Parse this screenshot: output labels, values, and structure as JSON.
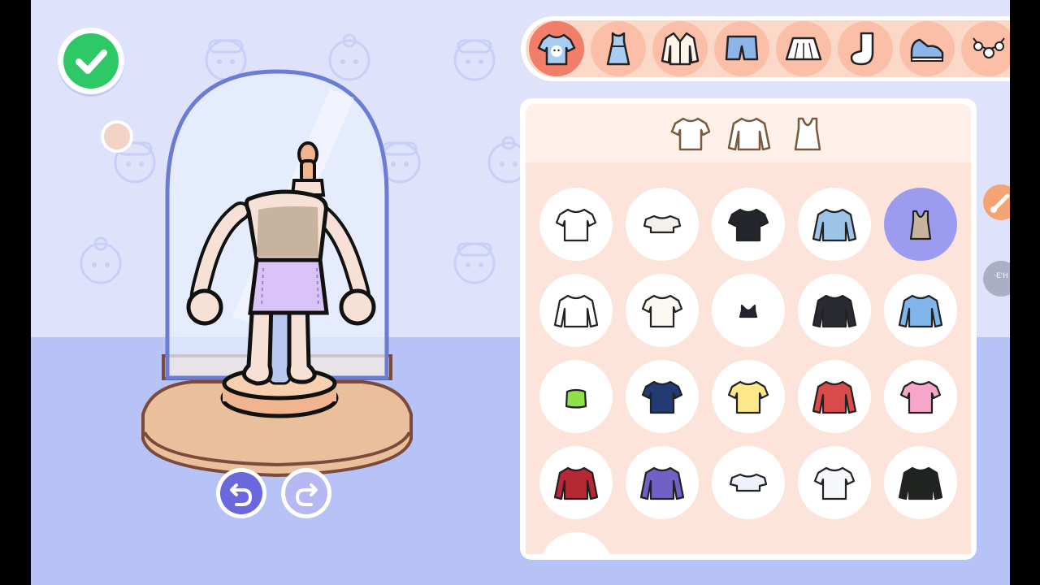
{
  "app": {
    "confirm_label": "",
    "side_badge": "·E'H"
  },
  "colors": {
    "background": "#dfe2fb",
    "floor": "#b7c2f6",
    "confirm": "#2ec866",
    "category_active": "#f07e68",
    "category": "#fbbfa8",
    "selected_item": "#9b9cf0",
    "skin_tone": "#f3d3c6"
  },
  "categories": [
    {
      "name": "tops",
      "icon": "tshirt-face-icon",
      "active": true
    },
    {
      "name": "dresses",
      "icon": "dress-icon",
      "active": false
    },
    {
      "name": "jackets",
      "icon": "jacket-icon",
      "active": false
    },
    {
      "name": "pants",
      "icon": "shorts-icon",
      "active": false
    },
    {
      "name": "skirts",
      "icon": "skirt-icon",
      "active": false
    },
    {
      "name": "socks",
      "icon": "sock-icon",
      "active": false
    },
    {
      "name": "shoes",
      "icon": "sneaker-icon",
      "active": false
    },
    {
      "name": "accessories",
      "icon": "necklace-icon",
      "active": false
    }
  ],
  "subtabs": [
    {
      "icon": "short-sleeve-shirt-icon"
    },
    {
      "icon": "long-sleeve-shirt-icon"
    },
    {
      "icon": "tank-top-icon"
    }
  ],
  "items": [
    {
      "icon": "white-tshirt-icon",
      "color": "#ffffff",
      "selected": false
    },
    {
      "icon": "white-crop-top-icon",
      "color": "#f4f1ea",
      "selected": false
    },
    {
      "icon": "black-graphic-tshirt-icon",
      "color": "#23262b",
      "selected": false
    },
    {
      "icon": "striped-long-sleeve-icon",
      "color": "#9dc3e6",
      "selected": false
    },
    {
      "icon": "beige-tank-top-icon",
      "color": "#c8b49e",
      "selected": true
    },
    {
      "icon": "white-collared-shirt-icon",
      "color": "#ffffff",
      "selected": false
    },
    {
      "icon": "white-tee-icon",
      "color": "#fbf8f1",
      "selected": false
    },
    {
      "icon": "black-cami-icon",
      "color": "#222436",
      "selected": false
    },
    {
      "icon": "black-cat-sweater-icon",
      "color": "#2a2a33",
      "selected": false
    },
    {
      "icon": "blue-chick-sweater-icon",
      "color": "#7fb5ea",
      "selected": false
    },
    {
      "icon": "green-tube-top-icon",
      "color": "#8ee04d",
      "selected": false
    },
    {
      "icon": "navy-flower-tshirt-icon",
      "color": "#223b73",
      "selected": false
    },
    {
      "icon": "yellow-tshirt-icon",
      "color": "#fde78a",
      "selected": false
    },
    {
      "icon": "christmas-cardigan-icon",
      "color": "#d94a4a",
      "selected": false
    },
    {
      "icon": "rainbow-tshirt-icon",
      "color": "#f7a6c9",
      "selected": false
    },
    {
      "icon": "red-track-jacket-icon",
      "color": "#b52834",
      "selected": false
    },
    {
      "icon": "purple-puffer-jacket-icon",
      "color": "#7360c4",
      "selected": false
    },
    {
      "icon": "pastel-crop-top-icon",
      "color": "#eef2fb",
      "selected": false
    },
    {
      "icon": "pastel-print-tshirt-icon",
      "color": "#f5f7fb",
      "selected": false
    },
    {
      "icon": "black-green-crop-sweater-icon",
      "color": "#1f2421",
      "selected": false
    }
  ],
  "mannequin": {
    "top_color": "#c8b49e",
    "skirt_color": "#d9c3f7"
  }
}
